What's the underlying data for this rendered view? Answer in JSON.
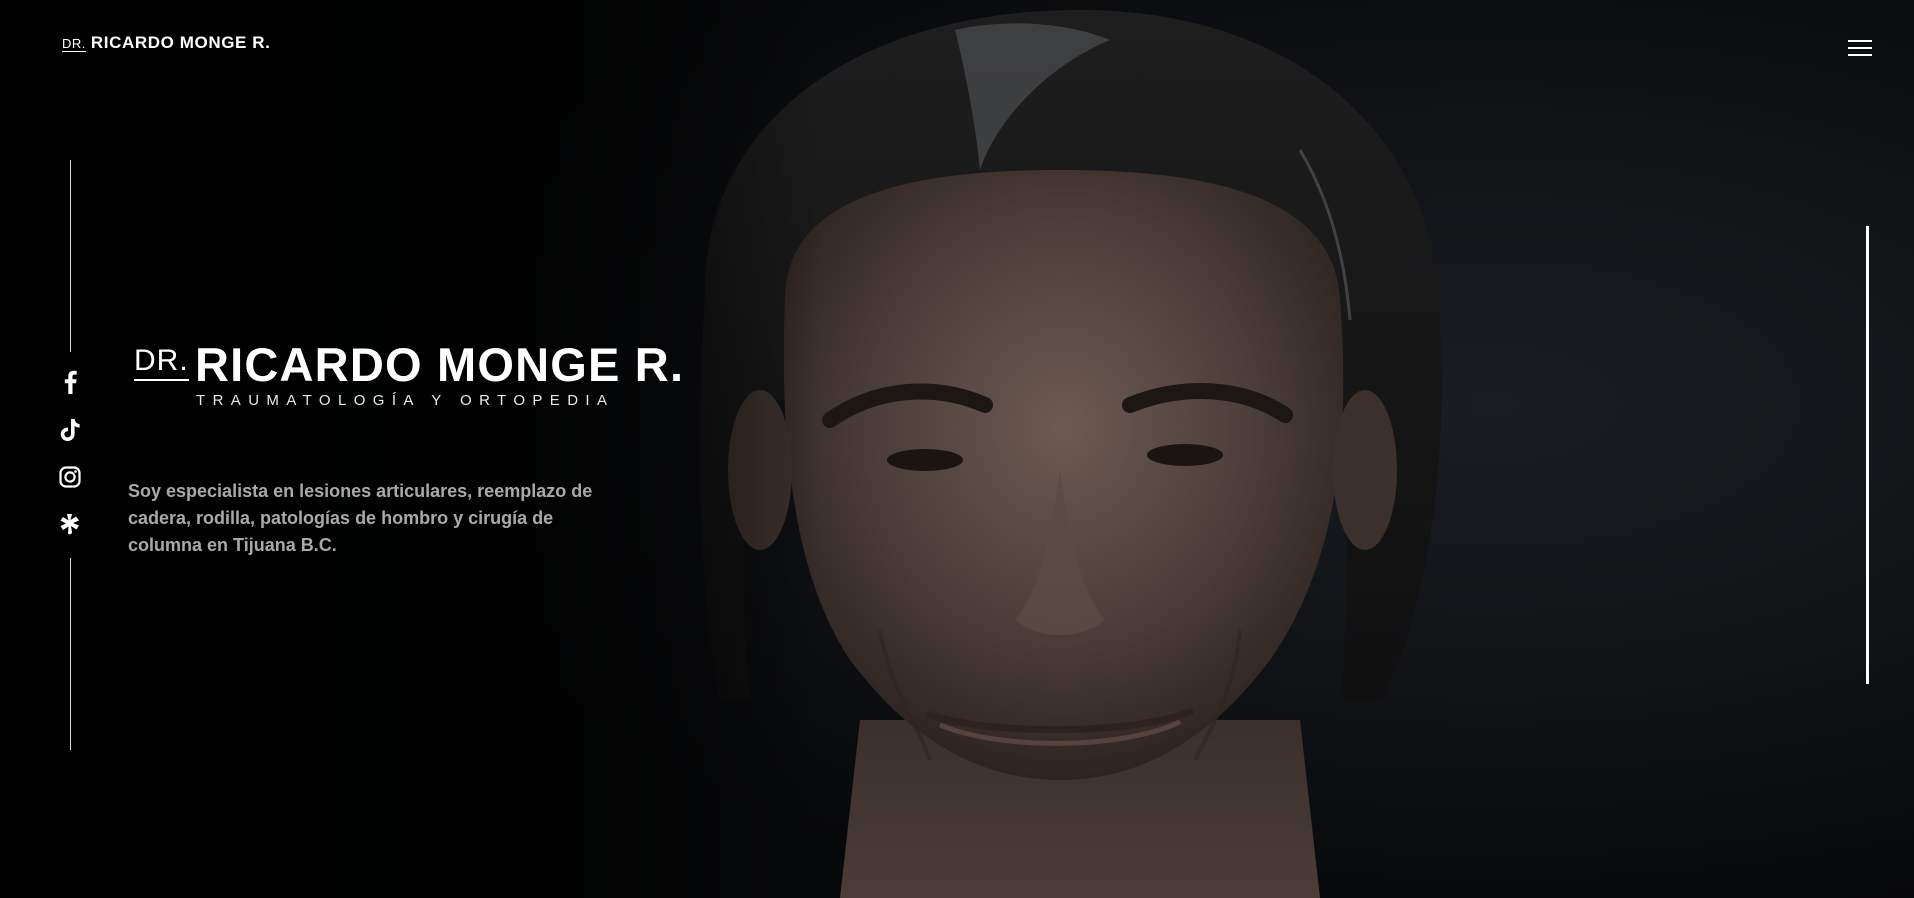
{
  "header": {
    "logo_prefix": "DR.",
    "logo_name": "RICARDO MONGE R.",
    "menu_icon": "hamburger-icon"
  },
  "hero": {
    "title_prefix": "DR.",
    "title_name": "RICARDO MONGE R.",
    "specialty": "TRAUMATOLOGÍA Y ORTOPEDIA",
    "intro": "Soy especialista en lesiones articulares, reemplazo de cadera, rodilla, patologías de hombro y cirugía de columna en Tijuana B.C.",
    "background_image": "portrait-photo"
  },
  "social": [
    {
      "name": "facebook",
      "icon": "facebook-icon"
    },
    {
      "name": "tiktok",
      "icon": "tiktok-icon"
    },
    {
      "name": "instagram",
      "icon": "instagram-icon"
    },
    {
      "name": "doctoralia",
      "icon": "doctoralia-icon"
    }
  ],
  "colors": {
    "background": "#050607",
    "text": "#ffffff",
    "intro_text": "#a9a9a9"
  }
}
